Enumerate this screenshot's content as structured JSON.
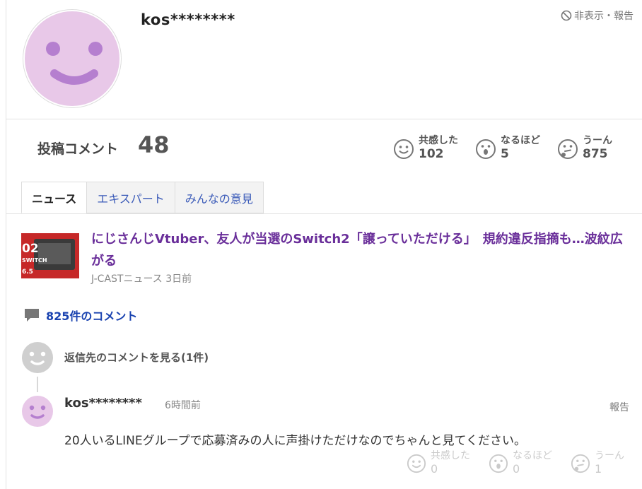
{
  "profile": {
    "username": "kos********",
    "hide_report": "非表示・報告"
  },
  "stats": {
    "posted_label": "投稿コメント",
    "posted_count": "48",
    "reactions": [
      {
        "label": "共感した",
        "count": "102"
      },
      {
        "label": "なるほど",
        "count": "5"
      },
      {
        "label": "うーん",
        "count": "875"
      }
    ]
  },
  "tabs": [
    {
      "label": "ニュース",
      "active": true
    },
    {
      "label": "エキスパート",
      "active": false
    },
    {
      "label": "みんなの意見",
      "active": false
    }
  ],
  "article": {
    "title": "にじさんじVtuber、友人が当選のSwitch2「譲っていただける」　規約違反指摘も…波紋広がる",
    "source": "J-CASTニュース",
    "time": "3日前",
    "thumb_text": "02",
    "thumb_sub": "SWITCH",
    "thumb_date": "6.5"
  },
  "comment_count": "825件のコメント",
  "reply_link": "返信先のコメントを見る(1件)",
  "comment": {
    "user": "kos********",
    "time": "6時間前",
    "report": "報告",
    "body": "20人いるLINEグループで応募済みの人に声掛けただけなのでちゃんと見てください。",
    "reactions": [
      {
        "label": "共感した",
        "count": "0"
      },
      {
        "label": "なるほど",
        "count": "0"
      },
      {
        "label": "うーん",
        "count": "1"
      }
    ]
  },
  "colors": {
    "avatar": "#e8c8e8",
    "avatar_face": "#b57fcf",
    "link": "#1a43b0",
    "title": "#6a2f9a"
  }
}
